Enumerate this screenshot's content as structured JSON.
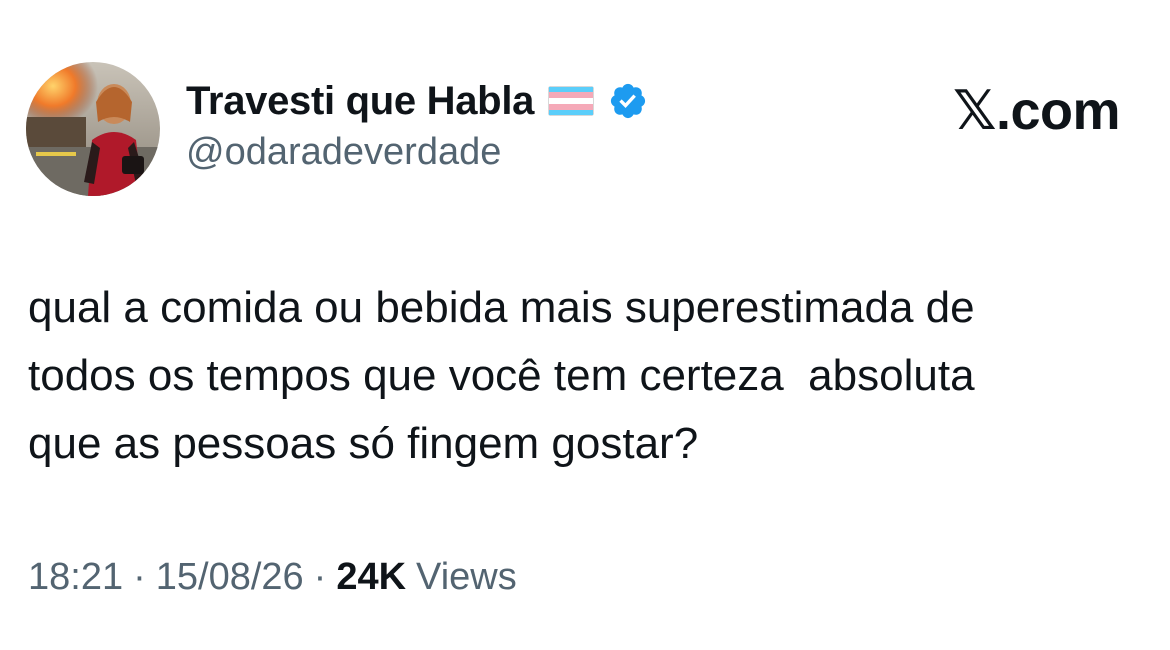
{
  "author": {
    "display_name": "Travesti que Habla",
    "handle": "@odaradeverdade",
    "flag_icon": "transgender-flag",
    "verified_icon": "verified-badge",
    "verified_color": "#1d9bf0"
  },
  "brand": {
    "label": "𝕏.com"
  },
  "tweet": {
    "text": "qual a comida ou bebida mais superestimada de\ntodos os tempos que você tem certeza  absoluta\nque as pessoas só fingem gostar?"
  },
  "meta": {
    "time": "18:21",
    "separator": "·",
    "date": "15/08/26",
    "views_count": "24K",
    "views_label": "Views"
  },
  "colors": {
    "text": "#0f1419",
    "secondary": "#536471",
    "flag_blue": "#5bcefa",
    "flag_pink": "#f5a9b8",
    "flag_white": "#ffffff"
  }
}
